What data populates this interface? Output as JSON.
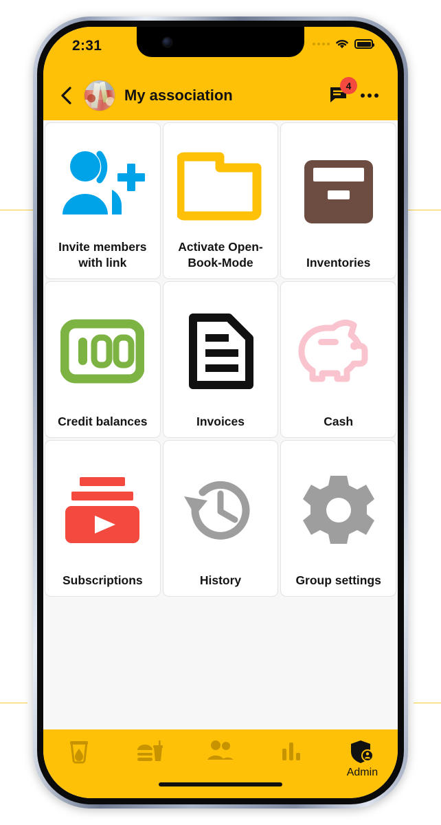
{
  "status_bar": {
    "time": "2:31",
    "cellular_icon": "cellular-dots-icon",
    "wifi_icon": "wifi-icon",
    "battery_icon": "battery-full-icon"
  },
  "app_bar": {
    "back_icon": "chevron-left-icon",
    "avatar_icon": "group-avatar-photo",
    "title": "My association",
    "messages_icon": "chat-bubble-icon",
    "messages_badge": "4",
    "overflow_icon": "more-horizontal-icon"
  },
  "grid": {
    "tiles": [
      {
        "label": "Invite members with link",
        "icon": "person-add-icon",
        "color": "#00A3E8"
      },
      {
        "label": "Activate Open-Book-Mode",
        "icon": "open-folder-icon",
        "color": "#FFC107"
      },
      {
        "label": "Inventories",
        "icon": "archive-box-icon",
        "color": "#6D4C41"
      },
      {
        "label": "Credit balances",
        "icon": "banknote-100-icon",
        "color": "#7CB342"
      },
      {
        "label": "Invoices",
        "icon": "document-lines-icon",
        "color": "#111111"
      },
      {
        "label": "Cash",
        "icon": "piggy-bank-icon",
        "color": "#F9C4CE"
      },
      {
        "label": "Subscriptions",
        "icon": "video-stack-play-icon",
        "color": "#F4493F"
      },
      {
        "label": "History",
        "icon": "clock-rotate-left-icon",
        "color": "#9E9E9E"
      },
      {
        "label": "Group settings",
        "icon": "gear-icon",
        "color": "#9E9E9E"
      }
    ]
  },
  "bottom_nav": {
    "items": [
      {
        "label": "",
        "icon": "drink-glass-icon",
        "active": false
      },
      {
        "label": "",
        "icon": "food-burger-drink-icon",
        "active": false
      },
      {
        "label": "",
        "icon": "people-icon",
        "active": false
      },
      {
        "label": "",
        "icon": "bar-chart-icon",
        "active": false
      },
      {
        "label": "Admin",
        "icon": "shield-person-icon",
        "active": true
      }
    ]
  },
  "colors": {
    "brand_yellow": "#FFC107",
    "nav_inactive": "#C79400",
    "badge_red": "#F4493F",
    "screen_bg": "#F7F7F7",
    "tile_bg": "#FFFFFF"
  }
}
